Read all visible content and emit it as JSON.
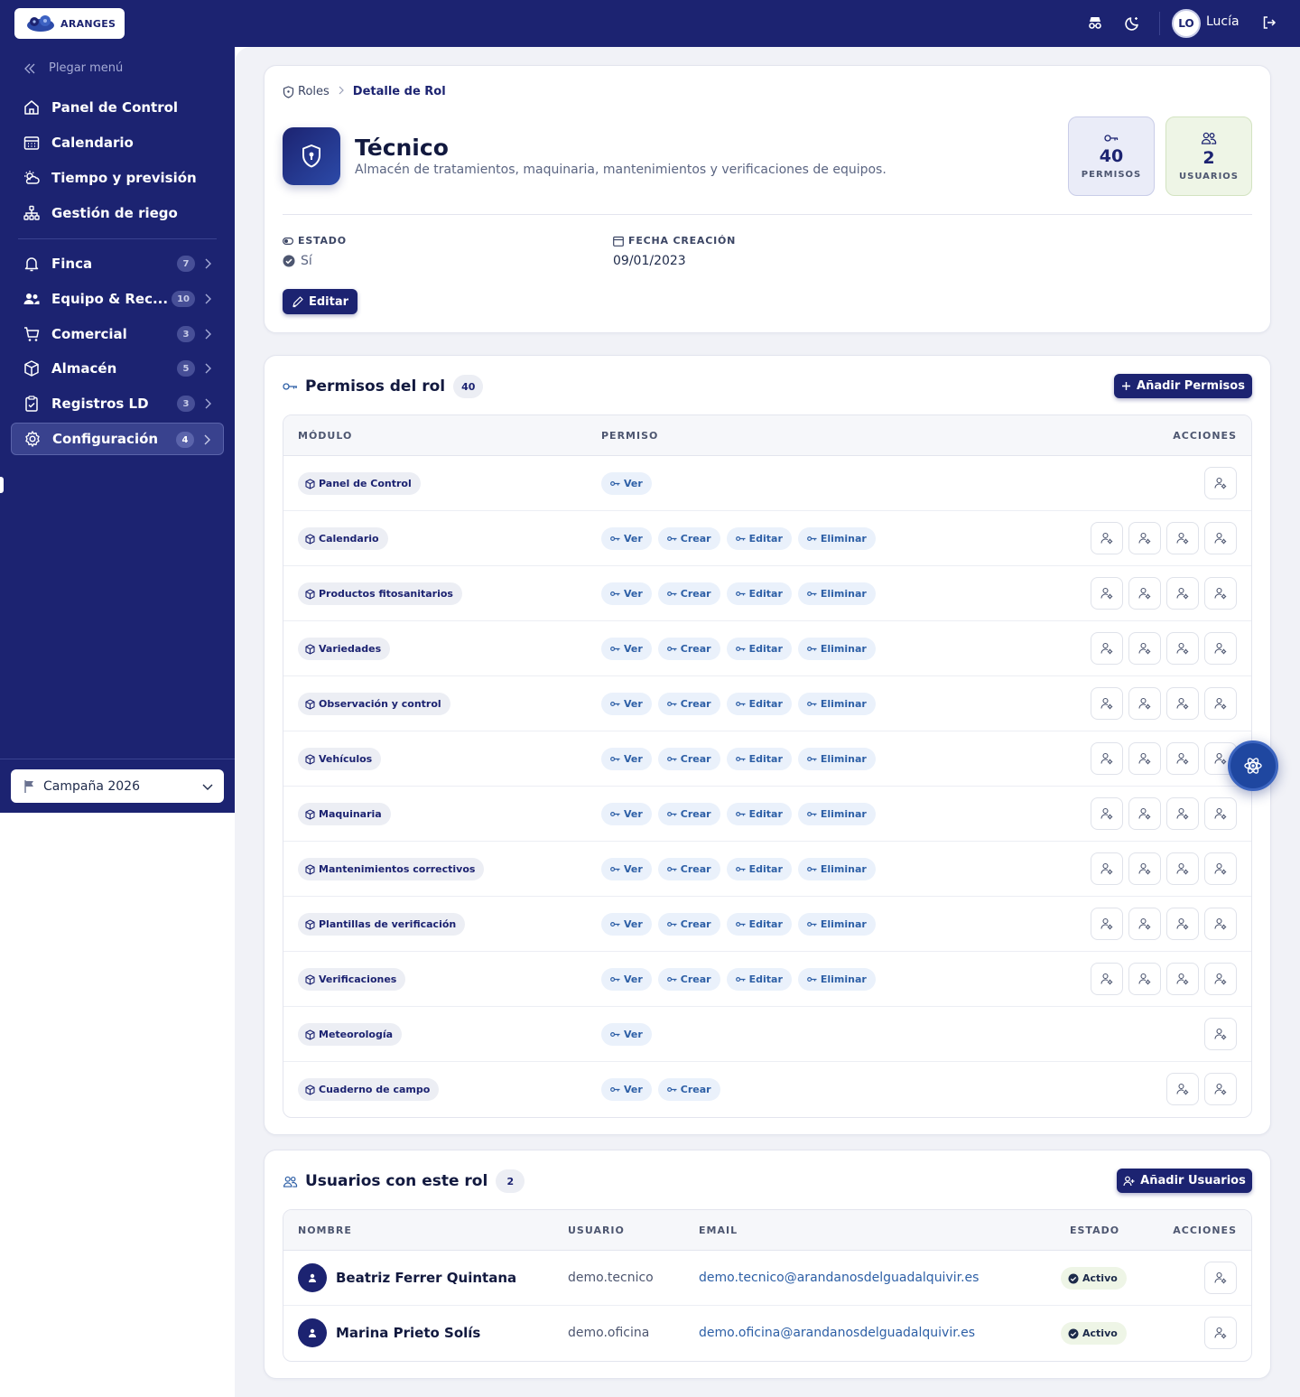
{
  "app": {
    "logo_text": "ARANGES"
  },
  "topbar": {
    "avatar_initials": "LO",
    "user_name": "Lucía"
  },
  "sidebar": {
    "collapse_label": "Plegar menú",
    "items": [
      {
        "label": "Panel de Control",
        "icon": "home-icon"
      },
      {
        "label": "Calendario",
        "icon": "calendar-icon"
      },
      {
        "label": "Tiempo y previsión",
        "icon": "weather-icon"
      },
      {
        "label": "Gestión de riego",
        "icon": "irrigation-icon"
      },
      {
        "label": "Finca",
        "icon": "bell-icon",
        "badge": "7"
      },
      {
        "label": "Equipo & Rec...",
        "icon": "team-icon",
        "badge": "10"
      },
      {
        "label": "Comercial",
        "icon": "cart-icon",
        "badge": "3"
      },
      {
        "label": "Almacén",
        "icon": "box-icon",
        "badge": "5"
      },
      {
        "label": "Registros LD",
        "icon": "clipboard-icon",
        "badge": "3"
      },
      {
        "label": "Configuración",
        "icon": "gear-icon",
        "badge": "4",
        "active": true
      }
    ],
    "campaign": "Campaña 2026"
  },
  "breadcrumb": {
    "parent": "Roles",
    "current": "Detalle de Rol"
  },
  "role": {
    "title": "Técnico",
    "description": "Almacén de tratamientos, maquinaria, mantenimientos y verificaciones de equipos.",
    "stats": {
      "permissions_value": "40",
      "permissions_label": "PERMISOS",
      "users_value": "2",
      "users_label": "USUARIOS"
    },
    "status_label": "ESTADO",
    "status_value": "Sí",
    "created_label": "FECHA CREACIÓN",
    "created_value": "09/01/2023",
    "edit_label": "Editar"
  },
  "permissions": {
    "title": "Permisos del rol",
    "count": "40",
    "add_label": "Añadir Permisos",
    "headers": {
      "module": "MÓDULO",
      "permission": "PERMISO",
      "actions": "ACCIONES"
    },
    "rows": [
      {
        "module": "Panel de Control",
        "perms": [
          "Ver"
        ]
      },
      {
        "module": "Calendario",
        "perms": [
          "Ver",
          "Crear",
          "Editar",
          "Eliminar"
        ]
      },
      {
        "module": "Productos fitosanitarios",
        "perms": [
          "Ver",
          "Crear",
          "Editar",
          "Eliminar"
        ]
      },
      {
        "module": "Variedades",
        "perms": [
          "Ver",
          "Crear",
          "Editar",
          "Eliminar"
        ]
      },
      {
        "module": "Observación y control",
        "perms": [
          "Ver",
          "Crear",
          "Editar",
          "Eliminar"
        ]
      },
      {
        "module": "Vehículos",
        "perms": [
          "Ver",
          "Crear",
          "Editar",
          "Eliminar"
        ]
      },
      {
        "module": "Maquinaria",
        "perms": [
          "Ver",
          "Crear",
          "Editar",
          "Eliminar"
        ]
      },
      {
        "module": "Mantenimientos correctivos",
        "perms": [
          "Ver",
          "Crear",
          "Editar",
          "Eliminar"
        ]
      },
      {
        "module": "Plantillas de verificación",
        "perms": [
          "Ver",
          "Crear",
          "Editar",
          "Eliminar"
        ]
      },
      {
        "module": "Verificaciones",
        "perms": [
          "Ver",
          "Crear",
          "Editar",
          "Eliminar"
        ]
      },
      {
        "module": "Meteorología",
        "perms": [
          "Ver"
        ]
      },
      {
        "module": "Cuaderno de campo",
        "perms": [
          "Ver",
          "Crear"
        ]
      }
    ]
  },
  "users": {
    "title": "Usuarios con este rol",
    "count": "2",
    "add_label": "Añadir Usuarios",
    "headers": {
      "name": "NOMBRE",
      "user": "USUARIO",
      "email": "EMAIL",
      "status": "ESTADO",
      "actions": "ACCIONES"
    },
    "rows": [
      {
        "name": "Beatriz Ferrer Quintana",
        "user": "demo.tecnico",
        "email": "demo.tecnico@arandanosdelguadalquivir.es",
        "status": "Activo"
      },
      {
        "name": "Marina Prieto Solís",
        "user": "demo.oficina",
        "email": "demo.oficina@arandanosdelguadalquivir.es",
        "status": "Activo"
      }
    ]
  },
  "colors": {
    "brand": "#1c2371",
    "accent": "#2d5fa6",
    "success_bg": "#eef5e6"
  }
}
